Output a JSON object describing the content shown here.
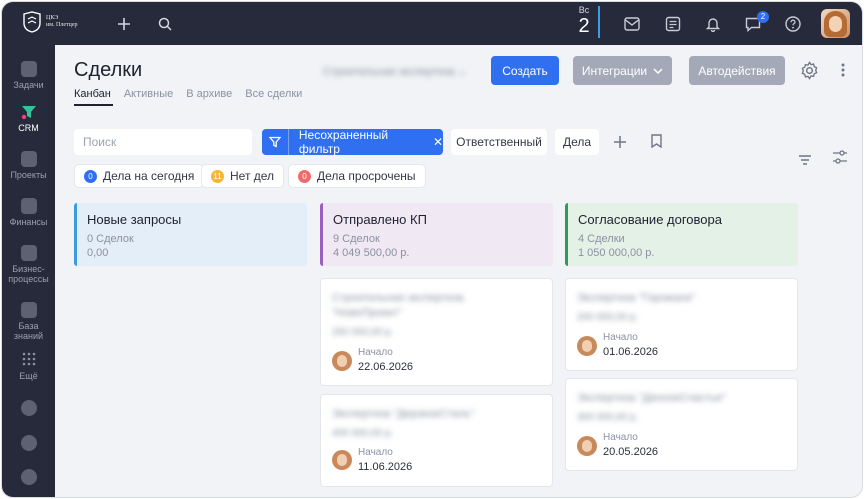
{
  "topbar": {
    "logo_line1": "ЦКЭ",
    "logo_line2": "им. Плетцер",
    "day_label": "Вс",
    "day_number": "2",
    "chat_badge": "2"
  },
  "sidebar": {
    "items": [
      {
        "label": "Задачи",
        "icon": "tasks-icon"
      },
      {
        "label": "CRM",
        "icon": "crm-funnel-icon"
      },
      {
        "label": "Проекты",
        "icon": "projects-icon"
      },
      {
        "label": "Финансы",
        "icon": "finance-icon"
      },
      {
        "label_line1": "Бизнес-",
        "label_line2": "процессы",
        "icon": "processes-icon"
      },
      {
        "label_line1": "База",
        "label_line2": "знаний",
        "icon": "knowledge-icon"
      },
      {
        "label": "Ещё",
        "icon": "more-dots-icon"
      }
    ]
  },
  "header": {
    "title": "Сделки",
    "pipeline": "Строительная экспертиза",
    "create_label": "Создать",
    "integrations_label": "Интеграции",
    "automation_label": "Автодействия",
    "tabs": [
      "Канбан",
      "Активные",
      "В архиве",
      "Все сделки"
    ]
  },
  "filters": {
    "search_placeholder": "Поиск",
    "active_filter": "Несохраненный фильтр",
    "responsible": "Ответственный",
    "tasks": "Дела"
  },
  "counters": [
    {
      "count": "0",
      "label": "Дела на сегодня",
      "color": "#2f6ff0"
    },
    {
      "count": "11",
      "label": "Нет дел",
      "color": "#f5b82e"
    },
    {
      "count": "0",
      "label": "Дела просрочены",
      "color": "#f06b6b"
    }
  ],
  "columns": [
    {
      "title": "Новые запросы",
      "count": "0 Сделок",
      "sum": "0,00",
      "accent": "#3a9be0",
      "bg": "#e4eef8"
    },
    {
      "title": "Отправлено КП",
      "count": "9 Сделок",
      "sum": "4 049 500,00 р.",
      "accent": "#9b5fc0",
      "bg": "#f0e8f3"
    },
    {
      "title": "Согласование договора",
      "count": "4 Сделки",
      "sum": "1 050 000,00 р.",
      "accent": "#2e9b5a",
      "bg": "#e4f1e7"
    }
  ],
  "cards": [
    {
      "title_line1": "Строительная экспертиза",
      "title_line2": "\"НовоПроект\"",
      "amount": "250 000,00 р.",
      "stage_label": "Начало",
      "date": "22.06.2026"
    },
    {
      "title_line1": "Экспертиза \"ДерзкоеСталь\"",
      "amount": "400 000,00 р.",
      "stage_label": "Начало",
      "date": "11.06.2026"
    },
    {
      "title_line1": "Экспертиза \"Горожане\"",
      "amount": "200 000,00 р.",
      "stage_label": "Начало",
      "date": "01.06.2026"
    },
    {
      "title_line1": "Экспертиза \"ДачноеСчастье\"",
      "amount": "300 000,00 р.",
      "stage_label": "Начало",
      "date": "20.05.2026"
    }
  ]
}
